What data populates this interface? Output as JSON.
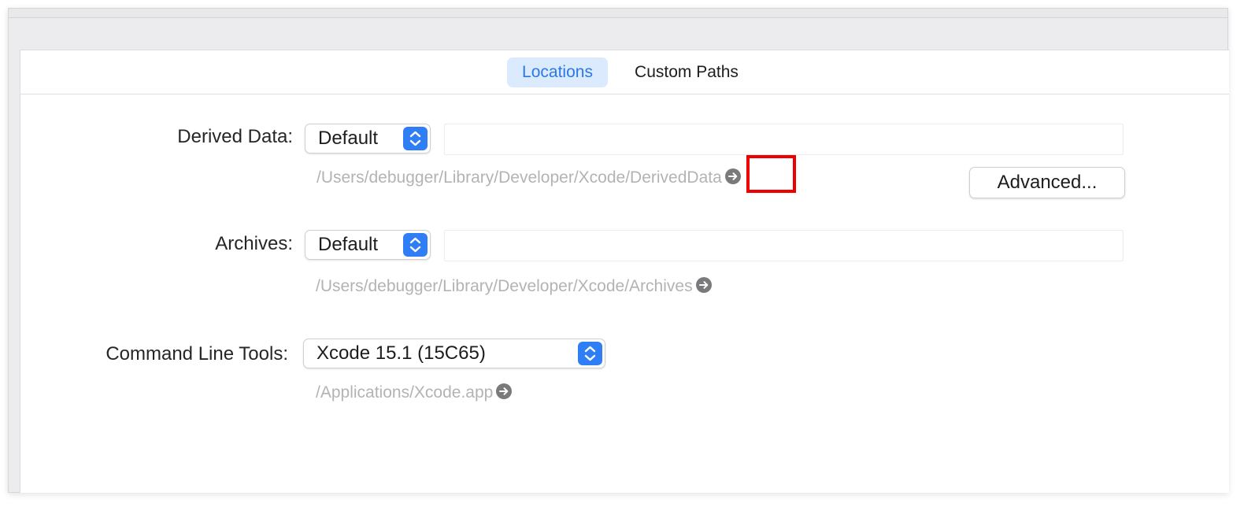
{
  "tabs": [
    {
      "label": "Locations",
      "selected": true
    },
    {
      "label": "Custom Paths",
      "selected": false
    }
  ],
  "derived_data": {
    "label": "Derived Data:",
    "selected": "Default",
    "path": "/Users/debugger/Library/Developer/Xcode/DerivedData"
  },
  "advanced_button": {
    "label": "Advanced..."
  },
  "archives": {
    "label": "Archives:",
    "selected": "Default",
    "path": "/Users/debugger/Library/Developer/Xcode/Archives"
  },
  "command_line_tools": {
    "label": "Command Line Tools:",
    "selected": "Xcode 15.1 (15C65)",
    "path": "/Applications/Xcode.app"
  },
  "colors": {
    "accent": "#2f7ef6",
    "selected_tab_bg": "#dbeafc",
    "selected_tab_text": "#2b79e4",
    "path_text": "#b3b3b6",
    "highlight_box": "#ee0000"
  }
}
